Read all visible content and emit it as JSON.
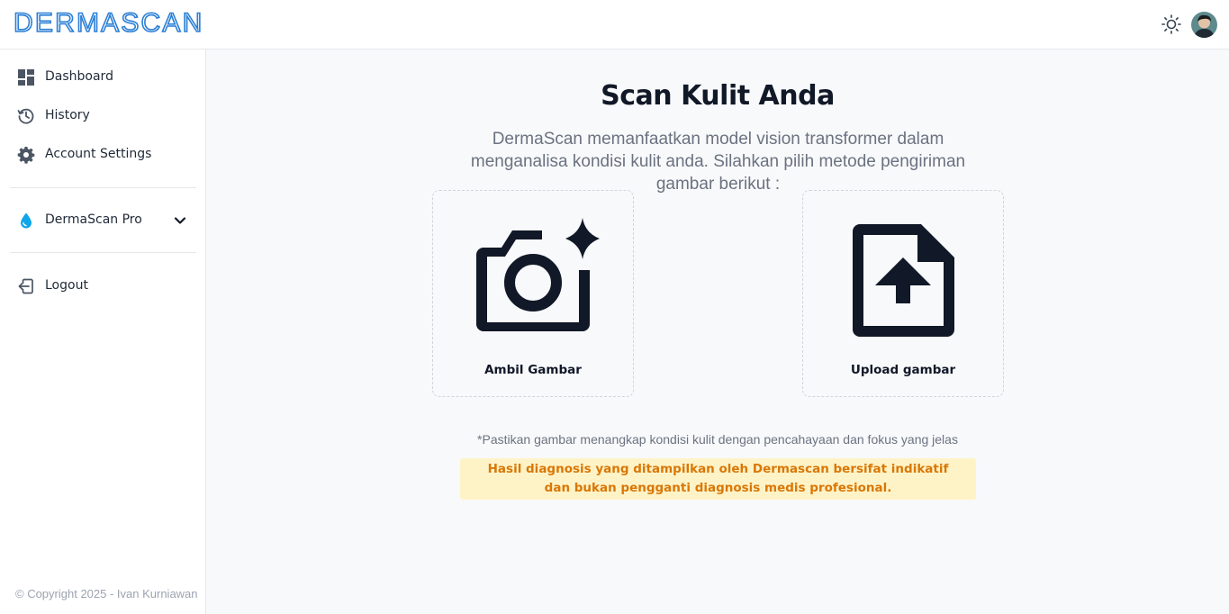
{
  "header": {
    "logo": "DERMASCAN",
    "theme_icon": "sun-icon",
    "avatar_icon": "user-avatar"
  },
  "sidebar": {
    "items": [
      {
        "label": "Dashboard",
        "icon": "dashboard-icon"
      },
      {
        "label": "History",
        "icon": "history-icon"
      },
      {
        "label": "Account Settings",
        "icon": "gear-icon"
      }
    ],
    "pro": {
      "label": "DermaScan Pro",
      "icon": "water-drop-icon",
      "chevron": "chevron-down-icon"
    },
    "logout": {
      "label": "Logout",
      "icon": "logout-icon"
    },
    "copyright": "© Copyright 2025 - Ivan Kurniawan"
  },
  "main": {
    "title": "Scan Kulit Anda",
    "subtitle": "DermaScan memanfaatkan model vision transformer dalam menganalisa kondisi kulit anda. Silahkan pilih metode pengiriman gambar berikut :",
    "options": [
      {
        "label": "Ambil Gambar",
        "icon": "camera-sparkle-icon"
      },
      {
        "label": "Upload gambar",
        "icon": "file-upload-icon"
      }
    ],
    "note": "*Pastikan gambar menangkap kondisi kulit dengan pencahayaan dan fokus yang jelas",
    "warning": "Hasil diagnosis yang ditampilkan oleh Dermascan bersifat indikatif dan bukan pengganti diagnosis medis profesional."
  },
  "colors": {
    "brand": "#2b7fd6",
    "dark": "#111827",
    "warning_bg": "#fef3c7",
    "warning_text": "#d97706",
    "pro_icon": "#0ea5e9"
  }
}
